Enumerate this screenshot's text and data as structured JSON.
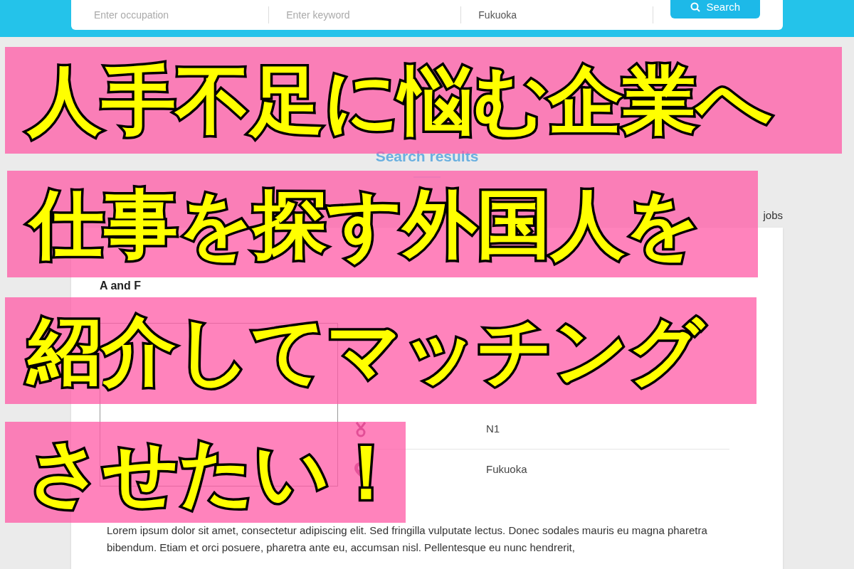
{
  "search_bar": {
    "fields": [
      {
        "placeholder": "Enter occupation"
      },
      {
        "placeholder": "Enter keyword"
      },
      {
        "value": "Fukuoka"
      }
    ],
    "button": "Search"
  },
  "results_heading": "Search results",
  "count": "jobs",
  "job": {
    "company": "A and F",
    "details": [
      {
        "kind": "qualification",
        "value": "N1"
      },
      {
        "kind": "location",
        "value": "Fukuoka"
      }
    ],
    "description": "Lorem ipsum dolor sit amet, consectetur adipiscing elit. Sed fringilla vulputate lectus. Donec sodales mauris eu magna pharetra bibendum. Etiam et orci posuere, pharetra ante eu, accumsan nisl. Pellentesque eu nunc hendrerit,"
  },
  "overlay_lines": [
    {
      "text": "人手不足に悩む企業へ"
    },
    {
      "text": "仕事を探す外国人を"
    },
    {
      "text": "紹介してマッチング"
    },
    {
      "text": "させたい！"
    }
  ]
}
